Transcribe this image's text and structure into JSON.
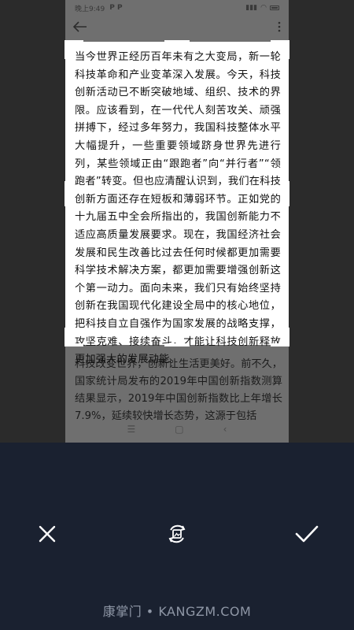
{
  "status_bar": {
    "time": "晚上9:49",
    "carrier_icons": "P P",
    "battery_icon": "battery-icon"
  },
  "toolbar": {
    "back_icon": "back-arrow-icon",
    "menu_icon": "more-vert-icon"
  },
  "document": {
    "cropped_text": "当今世界正经历百年未有之大变局，新一轮科技革命和产业变革深入发展。今天，科技创新活动已不断突破地域、组织、技术的界限。应该看到，在一代代人刻苦攻关、顽强拼搏下，经过多年努力，我国科技整体水平大幅提升，一些重要领域跻身世界先进行列，某些领域正由“跟跑者”向“并行者”“领跑者”转变。但也应清醒认识到，我们在科技创新方面还存在短板和薄弱环节。正如党的十九届五中全会所指出的，我国创新能力不适应高质量发展要求。现在，我国经济社会发展和民生改善比过去任何时候都更加需要科学技术解决方案，都更加需要增强创新这个第一动力。面向未来，我们只有始终坚持创新在我国现代化建设全局中的核心地位，把科技自立自强作为国家发展的战略支撑，攻坚克难、接续奋斗，才能让科技创新释放更加强大的发展动能。",
    "below_text": "科技改变世界，创新让生活更美好。前不久，国家统计局发布的2019年中国创新指数测算结果显示，2019年中国创新指数比上年增长7.9%，延续较快增长态势，这源于包括"
  },
  "actions": {
    "cancel_icon": "close-icon",
    "rotate_icon": "rotate-image-icon",
    "confirm_icon": "checkmark-icon"
  },
  "watermark": "康掌门 • KANGZM.COM"
}
